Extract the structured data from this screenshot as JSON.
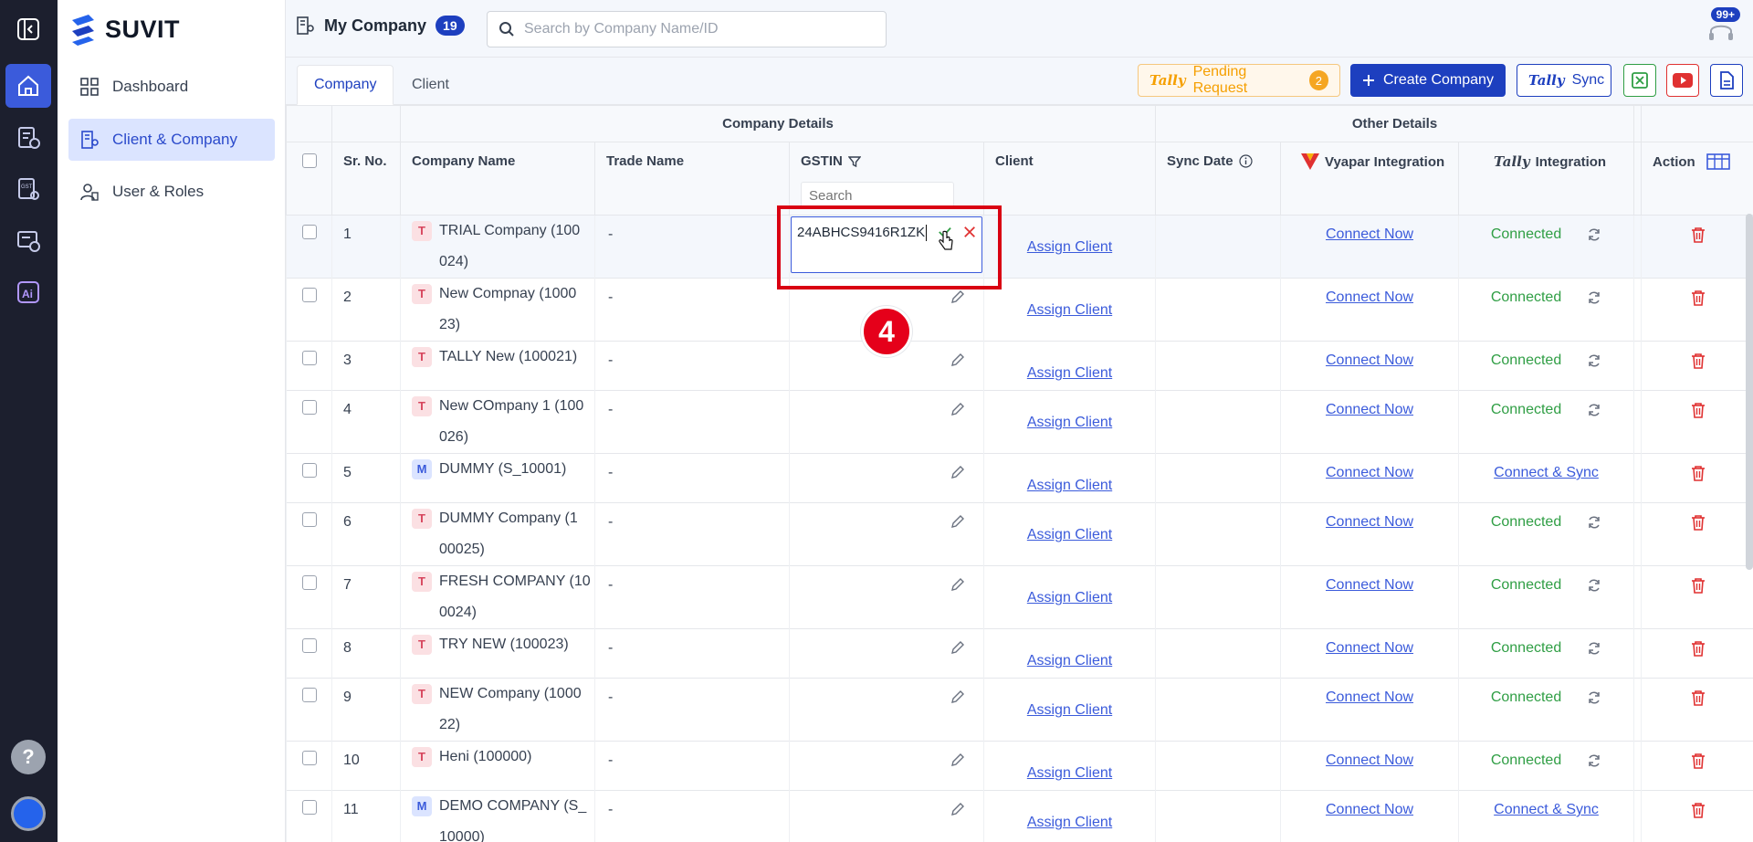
{
  "app": {
    "brand": "SUVIT"
  },
  "sidebar": {
    "items": [
      {
        "label": "Dashboard",
        "icon": "dashboard-grid-icon"
      },
      {
        "label": "Client & Company",
        "icon": "company-building-icon"
      },
      {
        "label": "User & Roles",
        "icon": "user-roles-icon"
      }
    ]
  },
  "rail": {
    "help_label": "?"
  },
  "header": {
    "title": "My Company",
    "count": "19",
    "search_placeholder": "Search by Company Name/ID",
    "notifications_count": "99+"
  },
  "tabs": [
    {
      "label": "Company"
    },
    {
      "label": "Client"
    }
  ],
  "toolbar": {
    "pending_brand": "Tally",
    "pending_label": "Pending Request",
    "pending_count": "2",
    "create_label": "Create Company",
    "sync_brand": "Tally",
    "sync_label": "Sync"
  },
  "table": {
    "group_headers": {
      "company": "Company Details",
      "other": "Other Details"
    },
    "headers": {
      "sr": "Sr. No.",
      "company_name": "Company Name",
      "trade_name": "Trade Name",
      "gstin": "GSTIN",
      "client": "Client",
      "sync_date": "Sync Date",
      "vyapar": "Vyapar Integration",
      "tally_brand": "Tally",
      "tally": "Integration",
      "action": "Action"
    },
    "gstin_filter_placeholder": "Search",
    "rows": [
      {
        "sr": "1",
        "tag": "T",
        "name_line1": "TRIAL Company (100",
        "name_line2": "024)",
        "trade": "-",
        "client_link": "Assign Client",
        "vyapar": "Connect Now",
        "tally_status": "Connected"
      },
      {
        "sr": "2",
        "tag": "T",
        "name_line1": "New Compnay (1000",
        "name_line2": "23)",
        "trade": "-",
        "client_link": "Assign Client",
        "vyapar": "Connect Now",
        "tally_status": "Connected"
      },
      {
        "sr": "3",
        "tag": "T",
        "name_line1": "TALLY New (100021)",
        "name_line2": "",
        "trade": "-",
        "client_link": "Assign Client",
        "vyapar": "Connect Now",
        "tally_status": "Connected"
      },
      {
        "sr": "4",
        "tag": "T",
        "name_line1": "New COmpany 1 (100",
        "name_line2": "026)",
        "trade": "-",
        "client_link": "Assign Client",
        "vyapar": "Connect Now",
        "tally_status": "Connected"
      },
      {
        "sr": "5",
        "tag": "M",
        "name_line1": "DUMMY (S_10001)",
        "name_line2": "",
        "trade": "-",
        "client_link": "Assign Client",
        "vyapar": "Connect Now",
        "tally_status": "Connect & Sync"
      },
      {
        "sr": "6",
        "tag": "T",
        "name_line1": "DUMMY Company (1",
        "name_line2": "00025)",
        "trade": "-",
        "client_link": "Assign Client",
        "vyapar": "Connect Now",
        "tally_status": "Connected"
      },
      {
        "sr": "7",
        "tag": "T",
        "name_line1": "FRESH COMPANY (10",
        "name_line2": "0024)",
        "trade": "-",
        "client_link": "Assign Client",
        "vyapar": "Connect Now",
        "tally_status": "Connected"
      },
      {
        "sr": "8",
        "tag": "T",
        "name_line1": "TRY NEW (100023)",
        "name_line2": "",
        "trade": "-",
        "client_link": "Assign Client",
        "vyapar": "Connect Now",
        "tally_status": "Connected"
      },
      {
        "sr": "9",
        "tag": "T",
        "name_line1": "NEW Company (1000",
        "name_line2": "22)",
        "trade": "-",
        "client_link": "Assign Client",
        "vyapar": "Connect Now",
        "tally_status": "Connected"
      },
      {
        "sr": "10",
        "tag": "T",
        "name_line1": "Heni (100000)",
        "name_line2": "",
        "trade": "-",
        "client_link": "Assign Client",
        "vyapar": "Connect Now",
        "tally_status": "Connected"
      },
      {
        "sr": "11",
        "tag": "M",
        "name_line1": "DEMO COMPANY (S_",
        "name_line2": "10000)",
        "trade": "-",
        "client_link": "Assign Client",
        "vyapar": "Connect Now",
        "tally_status": "Connect & Sync"
      }
    ]
  },
  "gstin_editor": {
    "value": "24ABHCS9416R1ZK"
  },
  "annotation": {
    "step": "4"
  },
  "colors": {
    "primary": "#1d3fbf",
    "success": "#2f9e44",
    "danger": "#e03131",
    "link": "#3b5bdb",
    "annotation": "#d90012"
  }
}
